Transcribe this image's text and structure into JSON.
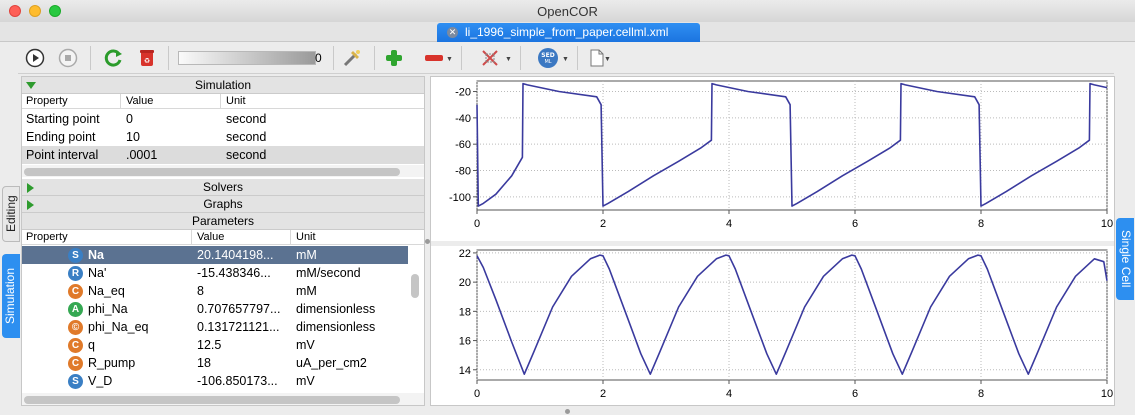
{
  "window": {
    "title": "OpenCOR",
    "traffic_lights": [
      "#fe5f57",
      "#febc2e",
      "#28c840"
    ]
  },
  "file_tab": {
    "label": "li_1996_simple_from_paper.cellml.xml"
  },
  "toolbar": {
    "progress_value": "0",
    "icons": [
      "run-icon",
      "stop-icon",
      "reset-icon",
      "clear-icon",
      "development-mode-icon",
      "add-graph-panel-icon",
      "remove-graph-panel-icon",
      "simulation-data-export-icon",
      "sedml-export-icon",
      "combine-archive-icon"
    ],
    "sedml_label": "SED ML"
  },
  "side_tabs": {
    "editing": "Editing",
    "simulation": "Simulation",
    "single_cell": "Single Cell"
  },
  "simulation": {
    "title": "Simulation",
    "columns": [
      "Property",
      "Value",
      "Unit"
    ],
    "rows": [
      {
        "property": "Starting point",
        "value": "0",
        "unit": "second"
      },
      {
        "property": "Ending point",
        "value": "10",
        "unit": "second"
      },
      {
        "property": "Point interval",
        "value": ".0001",
        "unit": "second"
      }
    ]
  },
  "solvers": {
    "title": "Solvers"
  },
  "graphs": {
    "title": "Graphs"
  },
  "parameters": {
    "title": "Parameters",
    "columns": [
      "Property",
      "Value",
      "Unit"
    ],
    "rows": [
      {
        "badge": "S",
        "badge_color": "#3a7fc4",
        "property": "Na",
        "value": "20.1404198...",
        "unit": "mM",
        "selected": true
      },
      {
        "badge": "R",
        "badge_color": "#3a7fc4",
        "property": "Na'",
        "value": "-15.438346...",
        "unit": "mM/second"
      },
      {
        "badge": "C",
        "badge_color": "#e07a2a",
        "property": "Na_eq",
        "value": "8",
        "unit": "mM"
      },
      {
        "badge": "A",
        "badge_color": "#35a853",
        "property": "phi_Na",
        "value": "0.707657797...",
        "unit": "dimensionless"
      },
      {
        "badge": "©",
        "badge_color": "#e07a2a",
        "property": "phi_Na_eq",
        "value": "0.131721121...",
        "unit": "dimensionless"
      },
      {
        "badge": "C",
        "badge_color": "#e07a2a",
        "property": "q",
        "value": "12.5",
        "unit": "mV"
      },
      {
        "badge": "C",
        "badge_color": "#e07a2a",
        "property": "R_pump",
        "value": "18",
        "unit": "uA_per_cm2"
      },
      {
        "badge": "S",
        "badge_color": "#3a7fc4",
        "property": "V_D",
        "value": "-106.850173...",
        "unit": "mV"
      }
    ]
  },
  "chart_data": [
    {
      "type": "line",
      "xlim": [
        0,
        10
      ],
      "ylim": [
        -110,
        -12
      ],
      "x_ticks": [
        "0",
        "2",
        "4",
        "6",
        "8",
        "10"
      ],
      "y_ticks": [
        "-20",
        "-40",
        "-60",
        "-80",
        "-100"
      ],
      "grid": true,
      "line_color": "#3a3a9e",
      "series": [
        {
          "x": [
            0,
            0.02,
            0.1,
            0.3,
            0.55,
            0.72,
            0.73,
            0.8,
            1.3,
            1.9,
            1.97,
            2.0,
            2.08,
            2.4,
            2.8,
            3.2,
            3.55,
            3.72,
            3.73,
            3.8,
            4.3,
            4.9,
            4.97,
            5.0,
            5.08,
            5.4,
            5.8,
            6.2,
            6.55,
            6.72,
            6.73,
            6.8,
            7.3,
            7.9,
            7.97,
            8.0,
            8.08,
            8.4,
            8.8,
            9.2,
            9.55,
            9.72,
            9.73,
            9.8,
            10.0
          ],
          "y": [
            -30,
            -107,
            -105,
            -98,
            -84,
            -70,
            -14,
            -15,
            -20,
            -24,
            -30,
            -107,
            -105,
            -96,
            -84,
            -73,
            -63,
            -57,
            -14,
            -15,
            -20,
            -24,
            -30,
            -107,
            -105,
            -96,
            -84,
            -73,
            -63,
            -57,
            -14,
            -15,
            -20,
            -24,
            -30,
            -107,
            -105,
            -96,
            -84,
            -73,
            -63,
            -57,
            -14,
            -15,
            -17
          ]
        }
      ]
    },
    {
      "type": "line",
      "xlim": [
        0,
        10
      ],
      "ylim": [
        13.3,
        22.2
      ],
      "x_ticks": [
        "0",
        "2",
        "4",
        "6",
        "8",
        "10"
      ],
      "y_ticks": [
        "22",
        "20",
        "18",
        "16",
        "14"
      ],
      "grid": true,
      "line_color": "#3a3a9e",
      "series": [
        {
          "x": [
            0,
            0.1,
            0.3,
            0.55,
            0.75,
            0.9,
            1.2,
            1.5,
            1.8,
            1.95,
            2.0,
            2.1,
            2.35,
            2.6,
            2.75,
            2.9,
            3.2,
            3.5,
            3.8,
            3.95,
            4.0,
            4.1,
            4.35,
            4.6,
            4.75,
            4.9,
            5.2,
            5.5,
            5.8,
            5.95,
            6.0,
            6.1,
            6.35,
            6.6,
            6.75,
            6.9,
            7.2,
            7.5,
            7.8,
            7.95,
            8.0,
            8.1,
            8.35,
            8.6,
            8.75,
            8.9,
            9.2,
            9.5,
            9.8,
            9.95,
            10.0
          ],
          "y": [
            21.8,
            21.0,
            18.8,
            15.9,
            13.7,
            15.2,
            18.3,
            20.4,
            21.6,
            21.85,
            21.8,
            20.9,
            18.0,
            15.1,
            13.7,
            15.2,
            18.3,
            20.4,
            21.6,
            21.85,
            21.8,
            20.9,
            18.0,
            15.1,
            13.7,
            15.2,
            18.3,
            20.4,
            21.6,
            21.85,
            21.8,
            20.9,
            18.0,
            15.1,
            13.7,
            15.2,
            18.3,
            20.4,
            21.6,
            21.85,
            21.8,
            20.9,
            18.0,
            15.1,
            13.7,
            15.2,
            18.3,
            20.4,
            21.6,
            21.4,
            20.1
          ]
        }
      ]
    }
  ]
}
